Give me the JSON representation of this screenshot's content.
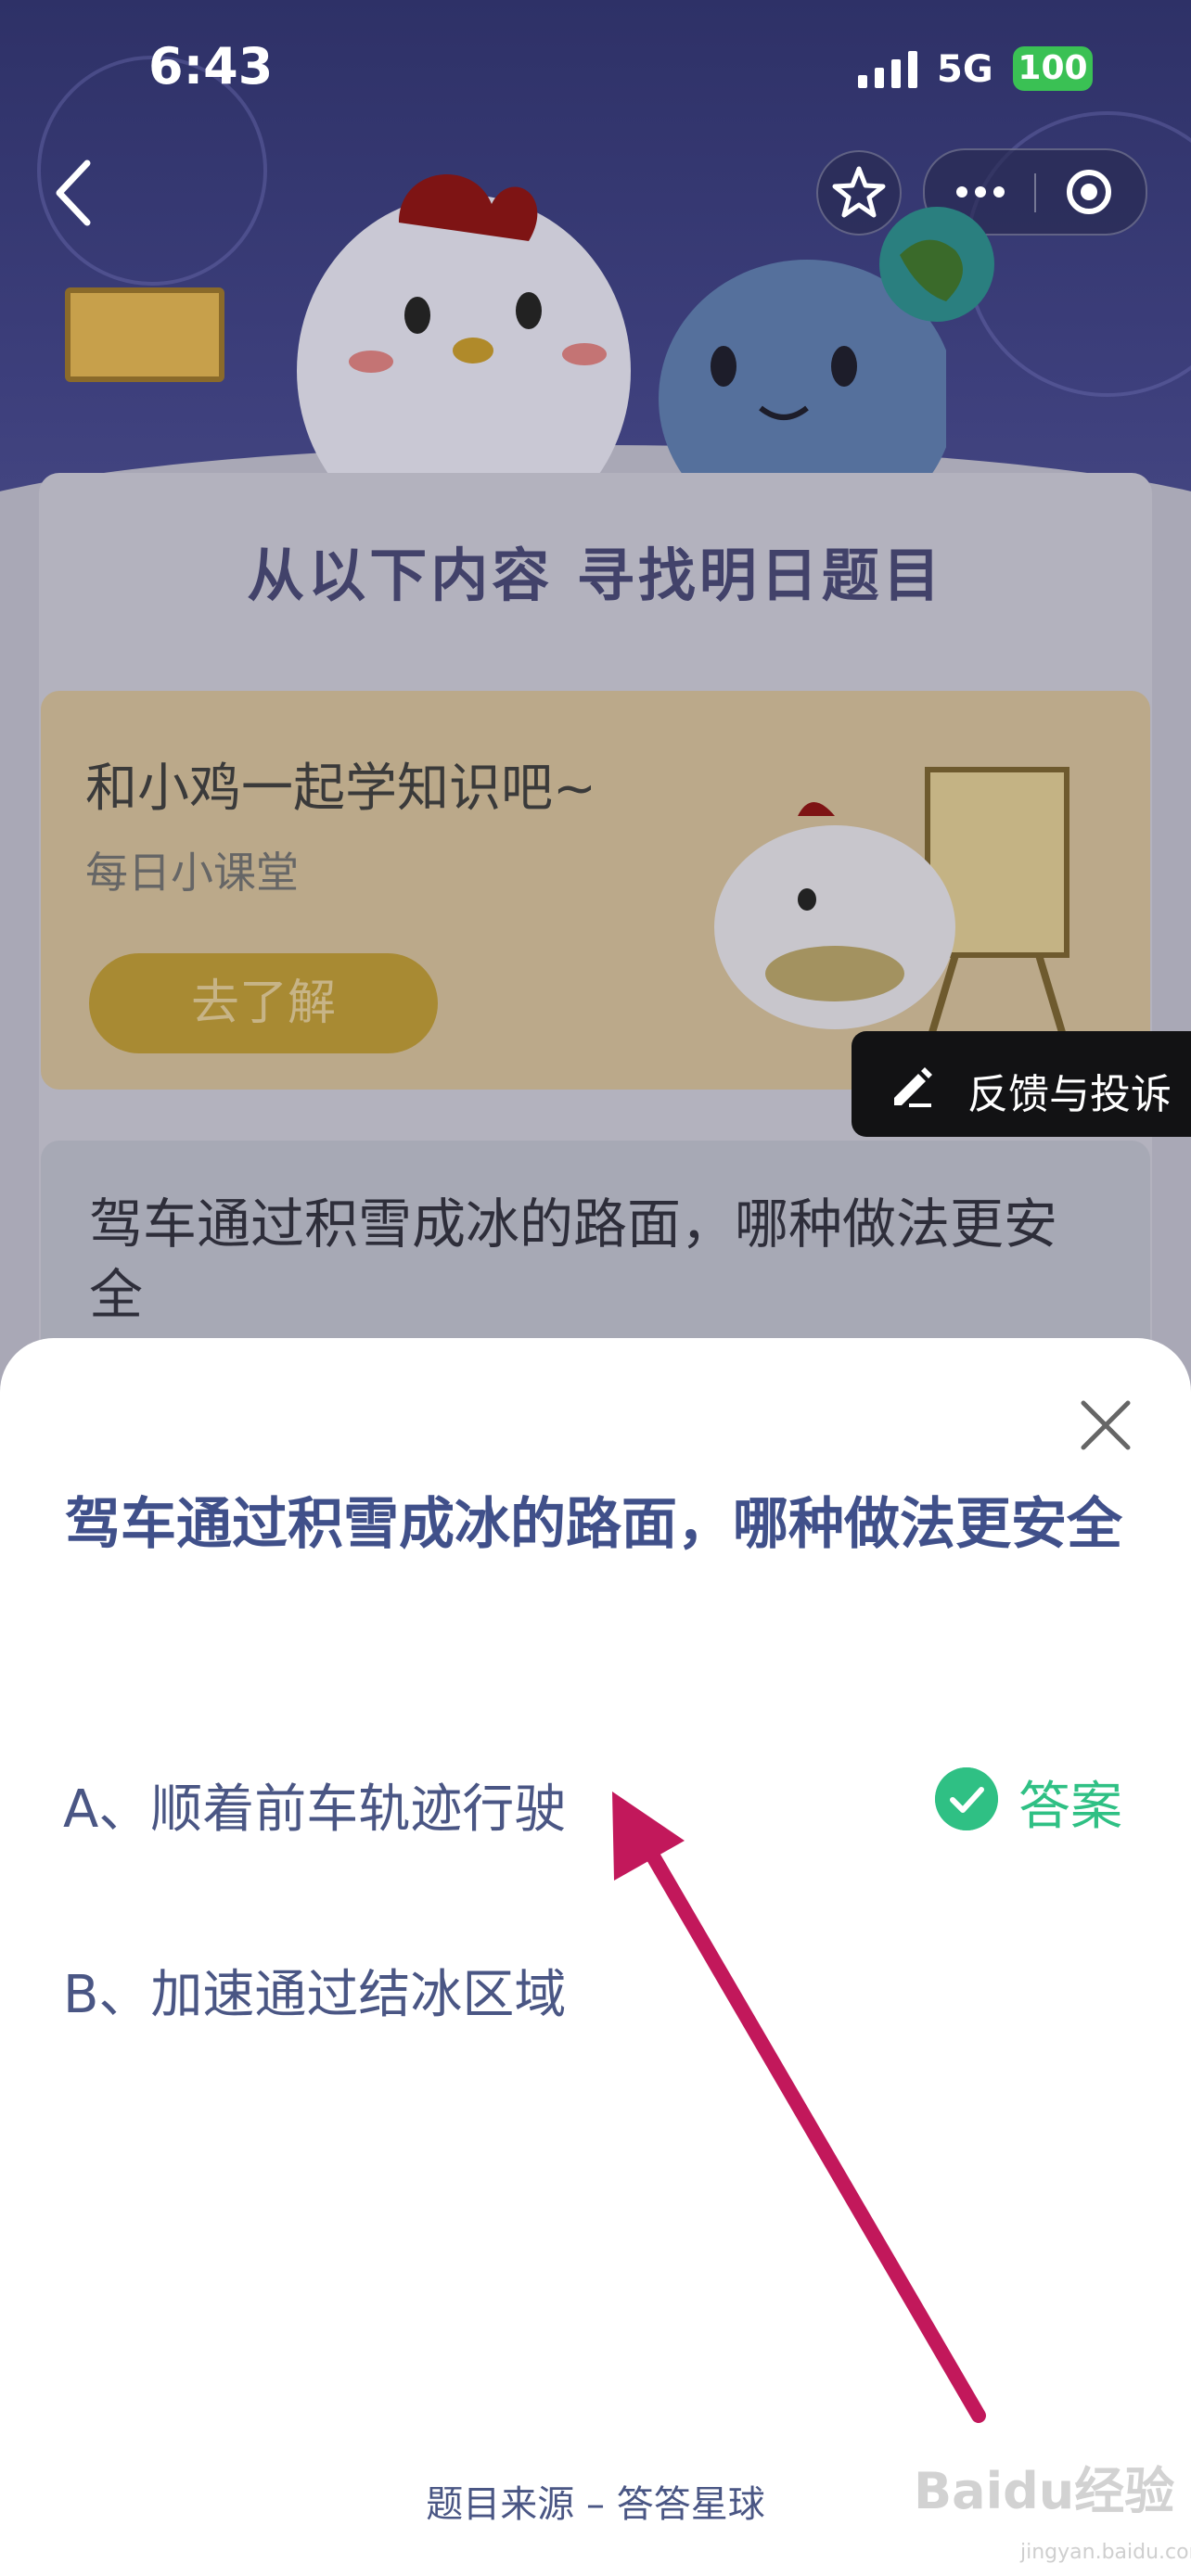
{
  "status_bar": {
    "time": "6:43",
    "network": "5G",
    "battery": "100"
  },
  "page": {
    "panel_title": "从以下内容  寻找明日题目",
    "card1": {
      "title": "和小鸡一起学知识吧~",
      "subtitle": "每日小课堂",
      "button": "去了解"
    },
    "card2": {
      "title": "驾车通过积雪成冰的路面，哪种做法更安全"
    },
    "feedback_label": "反馈与投诉"
  },
  "sheet": {
    "question": "驾车通过积雪成冰的路面，哪种做法更安全",
    "options": [
      {
        "label": "A、顺着前车轨迹行驶",
        "is_answer": true
      },
      {
        "label": "B、加速通过结冰区域",
        "is_answer": false
      }
    ],
    "answer_badge": "答案",
    "source": "题目来源 – 答答星球"
  },
  "watermark": {
    "brand": "Baidu经验",
    "url": "jingyan.baidu.com"
  },
  "colors": {
    "accent_answer": "#2fc084",
    "question_text": "#40508a",
    "arrow": "#c2185b"
  }
}
